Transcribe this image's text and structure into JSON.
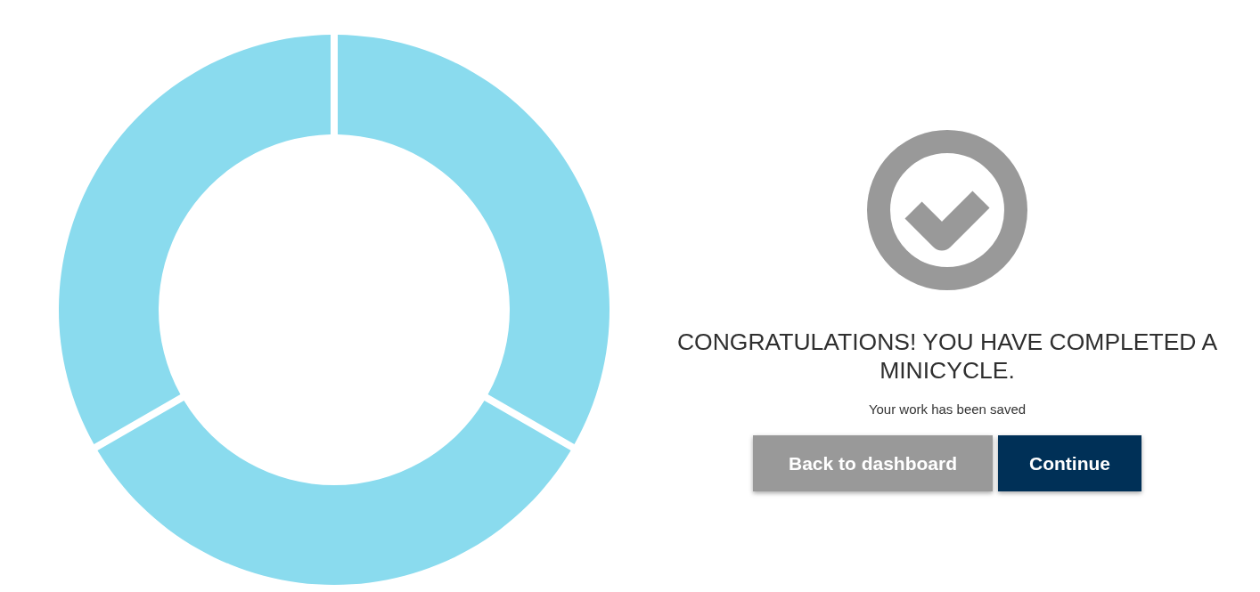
{
  "completion": {
    "title": "CONGRATULATIONS! YOU HAVE COMPLETED A MINICYCLE.",
    "subtitle": "Your work has been saved",
    "buttons": [
      {
        "label": "Back to dashboard",
        "kind": "secondary"
      },
      {
        "label": "Continue",
        "kind": "primary"
      }
    ]
  }
}
